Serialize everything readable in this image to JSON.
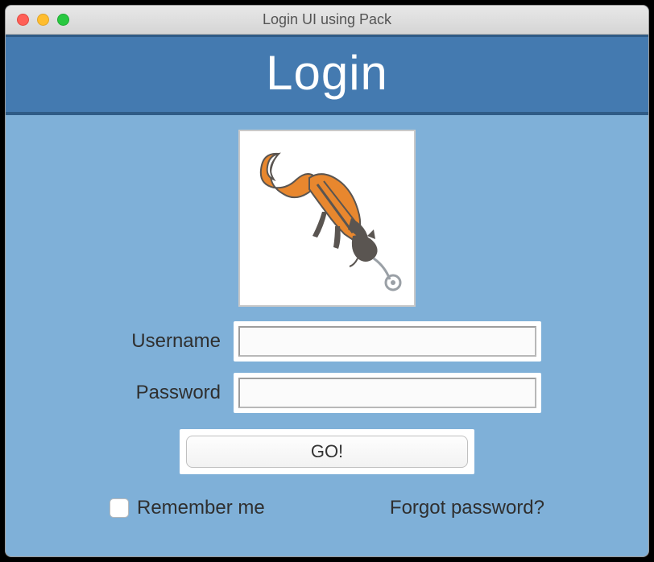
{
  "window": {
    "title": "Login UI using Pack"
  },
  "header": {
    "title": "Login"
  },
  "logo": {
    "name": "fox-illustration"
  },
  "form": {
    "username_label": "Username",
    "username_value": "",
    "password_label": "Password",
    "password_value": "",
    "submit_label": "GO!"
  },
  "options": {
    "remember_label": "Remember me",
    "remember_checked": false,
    "forgot_label": "Forgot password?"
  },
  "colors": {
    "banner_bg": "#447ab0",
    "body_bg": "#7fb0d8",
    "fox_orange": "#e8872e",
    "fox_dark": "#5a5551"
  }
}
